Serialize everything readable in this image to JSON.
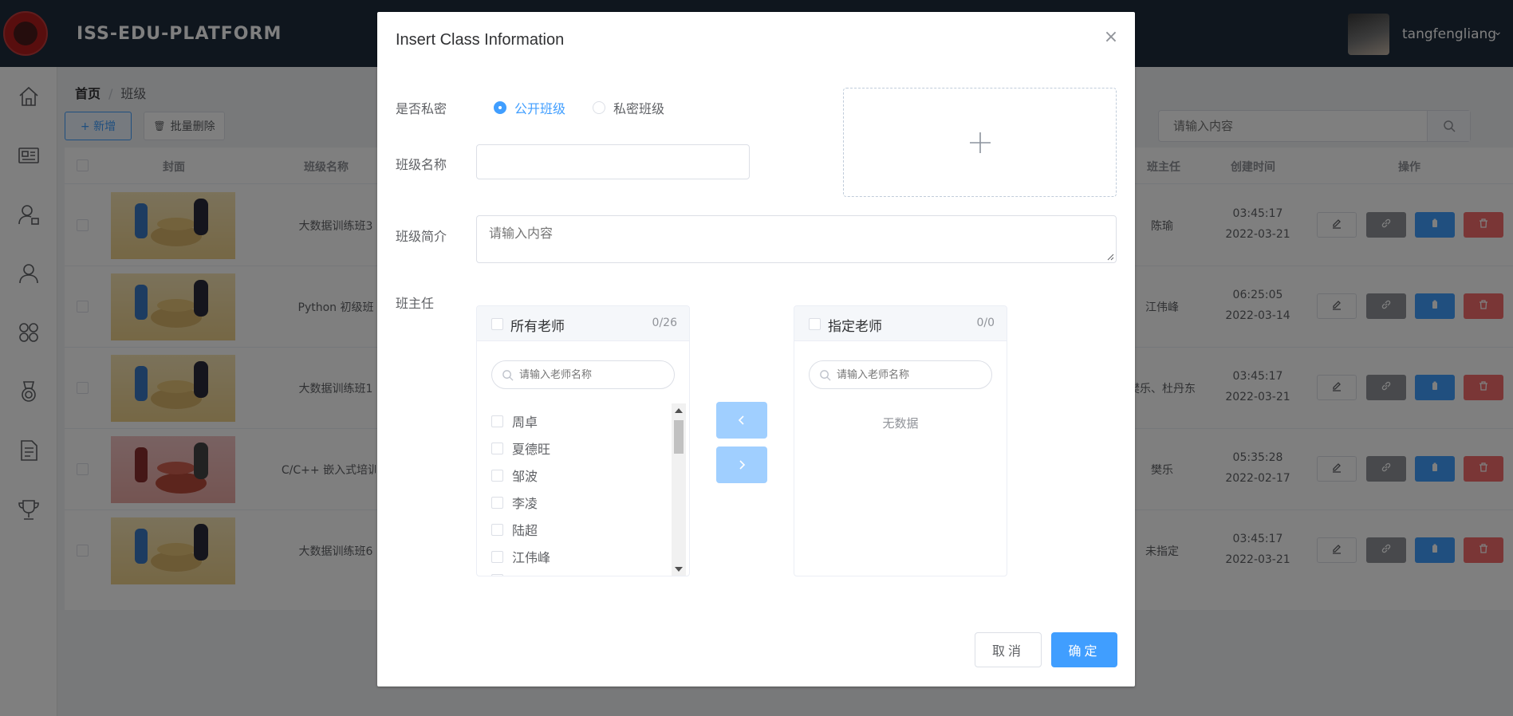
{
  "app": {
    "brand": "ISS-EDU-PLATFORM",
    "user_name": "tangfengliang",
    "user_caret": "⌄"
  },
  "breadcrumb": {
    "home": "首页",
    "separator": "/",
    "current": "班级"
  },
  "toolbar": {
    "add_label": "+ 新增",
    "batch_delete_label": "批量删除",
    "search_placeholder": "请输入内容"
  },
  "table": {
    "columns": {
      "cover": "封面",
      "class_name": "班级名称",
      "head_teacher": "班主任",
      "created_at": "创建时间",
      "actions": "操作"
    },
    "rows": [
      {
        "class_name": "大数据训练班3",
        "head_teacher": "陈瑜",
        "time": "03:45:17",
        "date": "2022-03-21",
        "cover": "yellow"
      },
      {
        "class_name": "Python 初级班",
        "head_teacher": "江伟峰",
        "time": "06:25:05",
        "date": "2022-03-14",
        "cover": "yellow"
      },
      {
        "class_name": "大数据训练班1",
        "head_teacher": "樊乐、杜丹东",
        "time": "03:45:17",
        "date": "2022-03-21",
        "cover": "yellow"
      },
      {
        "class_name": "C/C++ 嵌入式培训班",
        "head_teacher": "樊乐",
        "time": "05:35:28",
        "date": "2022-02-17",
        "cover": "red"
      },
      {
        "class_name": "大数据训练班6",
        "head_teacher": "未指定",
        "time": "03:45:17",
        "date": "2022-03-21",
        "cover": "yellow"
      }
    ]
  },
  "dialog": {
    "title": "Insert Class Information",
    "close_glyph": "×",
    "privacy_label": "是否私密",
    "radio_public": "公开班级",
    "radio_private": "私密班级",
    "privacy_value": "public",
    "class_name_label": "班级名称",
    "class_name_value": "",
    "intro_label": "班级简介",
    "intro_placeholder": "请输入内容",
    "teacher_label": "班主任",
    "left_panel": {
      "title": "所有老师",
      "count": "0/26",
      "search_placeholder": "请输入老师名称",
      "items": [
        "周卓",
        "夏德旺",
        "邹波",
        "李凌",
        "陆超",
        "江伟峰"
      ]
    },
    "right_panel": {
      "title": "指定老师",
      "count": "0/0",
      "search_placeholder": "请输入老师名称",
      "empty_text": "无数据"
    },
    "cancel_label": "取消",
    "confirm_label": "确定"
  },
  "colors": {
    "primary": "#409eff",
    "danger": "#f56c6c",
    "info": "#909399",
    "topbar": "#1f2d3d",
    "transfer_disabled": "#a0cfff"
  }
}
